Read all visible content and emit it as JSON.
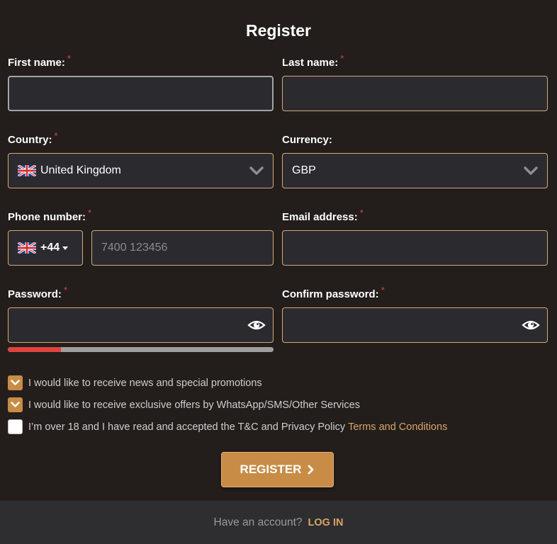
{
  "title": "Register",
  "fields": {
    "first_name": {
      "label": "First name:",
      "required": "*",
      "value": ""
    },
    "last_name": {
      "label": "Last name:",
      "required": "*",
      "value": ""
    },
    "country": {
      "label": "Country:",
      "required": "*",
      "value": "United Kingdom",
      "flag": "uk-flag-icon"
    },
    "currency": {
      "label": "Currency:",
      "value": "GBP"
    },
    "phone": {
      "label": "Phone number:",
      "required": "*",
      "code": "+44",
      "placeholder": "7400 123456",
      "value": ""
    },
    "email": {
      "label": "Email address:",
      "required": "*",
      "value": ""
    },
    "password": {
      "label": "Password:",
      "required": "*",
      "value": "",
      "strength": 0.2
    },
    "confirm_password": {
      "label": "Confirm password:",
      "required": "*",
      "value": ""
    }
  },
  "checkboxes": [
    {
      "label": "I would like to receive news and special promotions",
      "checked": true
    },
    {
      "label": "I would like to receive exclusive offers by WhatsApp/SMS/Other Services",
      "checked": true
    },
    {
      "label": "I’m over 18 and I have read and accepted the T&C and Privacy Policy",
      "link": "Terms and Conditions",
      "checked": false
    }
  ],
  "register_button": {
    "label": "REGISTER"
  },
  "footer": {
    "question": "Have an account?",
    "login_label": "LOG IN"
  },
  "colors": {
    "background": "#231e1b",
    "accent": "#c88c47",
    "field_border": "#d7a977",
    "required": "#e0433e",
    "strength_weak": "#e0433e"
  }
}
